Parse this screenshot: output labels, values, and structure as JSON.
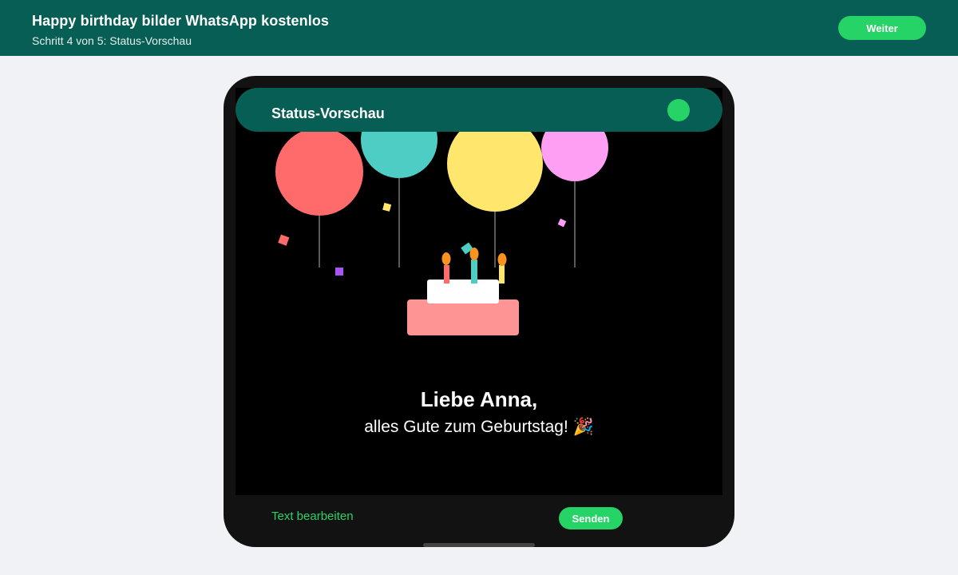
{
  "app": {
    "title": "Happy birthday bilder WhatsApp kostenlos",
    "step": "Schritt 4 von 5: Status-Vorschau",
    "next_label": "Weiter"
  },
  "preview": {
    "header_title": "Status-Vorschau",
    "greeting_name": "Liebe Anna,",
    "greeting_text": "alles Gute zum Geburtstag! 🎉",
    "edit_label": "Text bearbeiten",
    "send_label": "Senden"
  },
  "colors": {
    "brand_dark": "#075e54",
    "accent_green": "#25d366",
    "balloon_red": "#ff6b6b",
    "balloon_teal": "#4ecdc4",
    "balloon_yellow": "#ffe66d",
    "balloon_pink": "#ff9ff3"
  }
}
